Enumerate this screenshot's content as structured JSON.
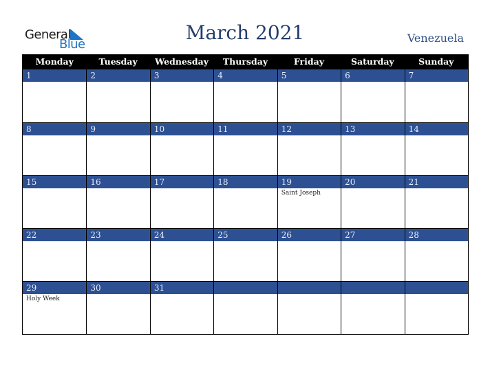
{
  "logo": {
    "line1": "General",
    "line2": "Blue"
  },
  "header": {
    "title": "March 2021",
    "country": "Venezuela"
  },
  "colors": {
    "accent": "#2d5093",
    "title": "#233d6b",
    "logo_blue": "#1f74c4",
    "header_bg": "#000000"
  },
  "weekdays": [
    "Monday",
    "Tuesday",
    "Wednesday",
    "Thursday",
    "Friday",
    "Saturday",
    "Sunday"
  ],
  "weeks": [
    [
      {
        "day": "1",
        "event": ""
      },
      {
        "day": "2",
        "event": ""
      },
      {
        "day": "3",
        "event": ""
      },
      {
        "day": "4",
        "event": ""
      },
      {
        "day": "5",
        "event": ""
      },
      {
        "day": "6",
        "event": ""
      },
      {
        "day": "7",
        "event": ""
      }
    ],
    [
      {
        "day": "8",
        "event": ""
      },
      {
        "day": "9",
        "event": ""
      },
      {
        "day": "10",
        "event": ""
      },
      {
        "day": "11",
        "event": ""
      },
      {
        "day": "12",
        "event": ""
      },
      {
        "day": "13",
        "event": ""
      },
      {
        "day": "14",
        "event": ""
      }
    ],
    [
      {
        "day": "15",
        "event": ""
      },
      {
        "day": "16",
        "event": ""
      },
      {
        "day": "17",
        "event": ""
      },
      {
        "day": "18",
        "event": ""
      },
      {
        "day": "19",
        "event": "Saint Joseph"
      },
      {
        "day": "20",
        "event": ""
      },
      {
        "day": "21",
        "event": ""
      }
    ],
    [
      {
        "day": "22",
        "event": ""
      },
      {
        "day": "23",
        "event": ""
      },
      {
        "day": "24",
        "event": ""
      },
      {
        "day": "25",
        "event": ""
      },
      {
        "day": "26",
        "event": ""
      },
      {
        "day": "27",
        "event": ""
      },
      {
        "day": "28",
        "event": ""
      }
    ],
    [
      {
        "day": "29",
        "event": "Holy Week"
      },
      {
        "day": "30",
        "event": ""
      },
      {
        "day": "31",
        "event": ""
      },
      {
        "day": "",
        "event": ""
      },
      {
        "day": "",
        "event": ""
      },
      {
        "day": "",
        "event": ""
      },
      {
        "day": "",
        "event": ""
      }
    ]
  ]
}
